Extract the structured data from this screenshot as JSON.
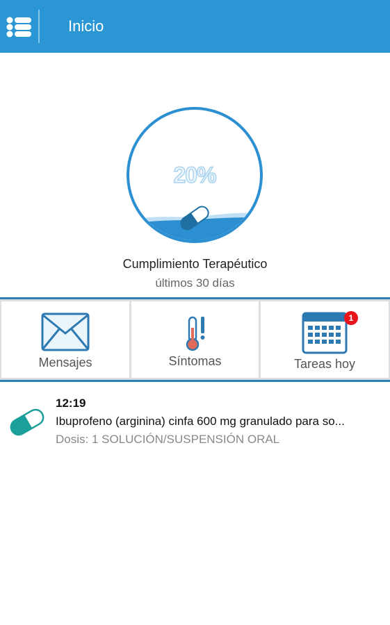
{
  "app_bar": {
    "title": "Inicio",
    "menu_icon": "list-menu-icon",
    "color": "#2b96d4"
  },
  "compliance": {
    "percent_label": "20%",
    "percent_value": 20,
    "title": "Cumplimiento Terapéutico",
    "subtitle": "últimos 30 días",
    "icon": "pill-capsule-icon",
    "water_color": "#2b8fd1"
  },
  "tiles": [
    {
      "label": "Mensajes",
      "icon": "envelope-icon"
    },
    {
      "label": "Síntomas",
      "icon": "thermometer-alert-icon"
    },
    {
      "label": "Tareas hoy",
      "icon": "calendar-icon",
      "badge": "1"
    }
  ],
  "dose_list": [
    {
      "time": "12:19",
      "name": "Ibuprofeno (arginina) cinfa 600 mg granulado para so...",
      "dosage": "Dosis: 1 SOLUCIÓN/SUSPENSIÓN ORAL",
      "icon": "pill-capsule-icon",
      "icon_color": "#1a9f9a"
    }
  ]
}
